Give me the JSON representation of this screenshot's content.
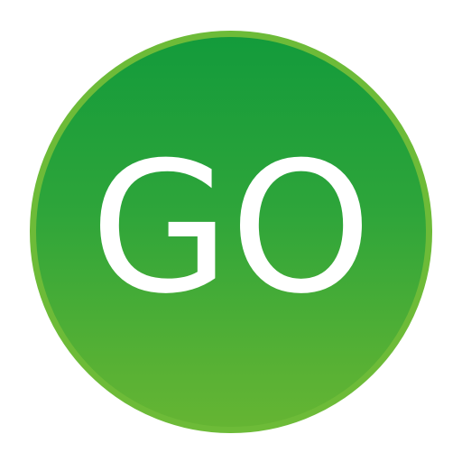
{
  "button": {
    "label": "GO",
    "colors": {
      "fill_top": "#139b3b",
      "fill_bottom": "#65b533",
      "ring": "#6dbb38",
      "text": "#ffffff",
      "background": "#ffffff"
    }
  }
}
